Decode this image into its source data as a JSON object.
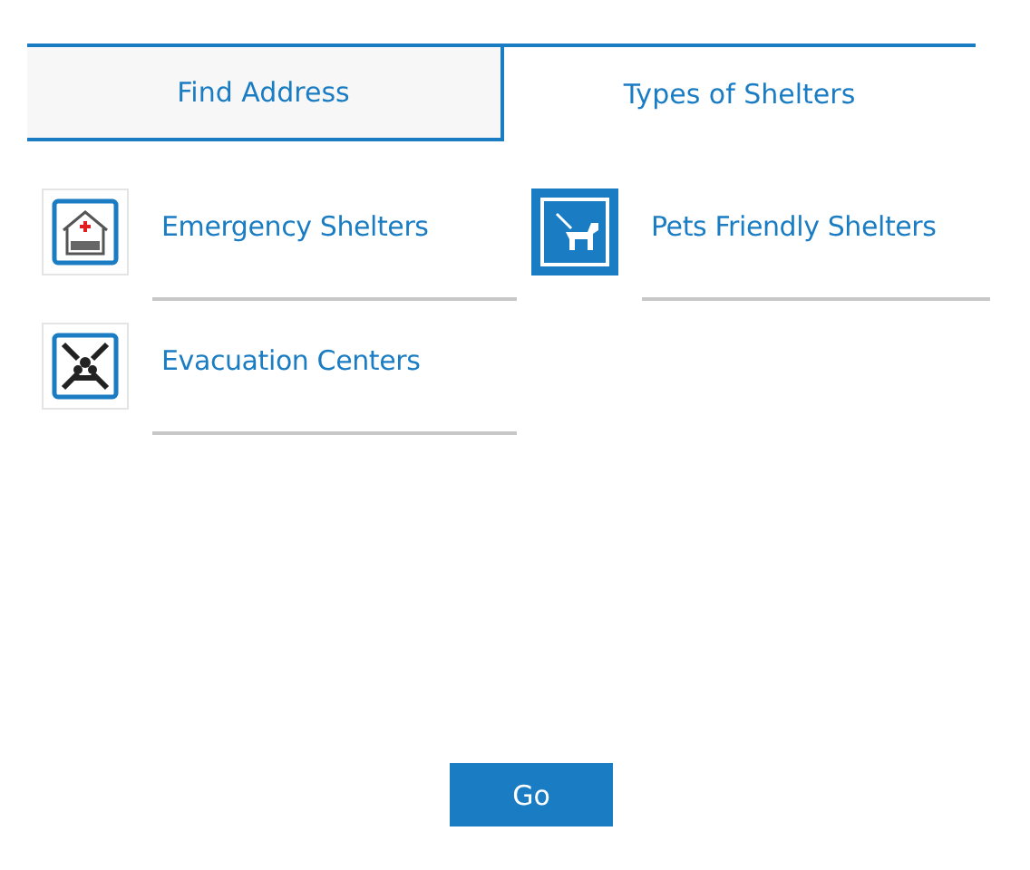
{
  "tabs": [
    {
      "label": "Find Address",
      "selected": false
    },
    {
      "label": "Types of Shelters",
      "selected": true
    }
  ],
  "shelter_types": [
    {
      "label": "Emergency Shelters",
      "kind": "emergency",
      "selected": false
    },
    {
      "label": "Pets Friendly Shelters",
      "kind": "pets",
      "selected": true
    },
    {
      "label": "Evacuation Centers",
      "kind": "evacuation",
      "selected": false
    }
  ],
  "go_button": "Go"
}
